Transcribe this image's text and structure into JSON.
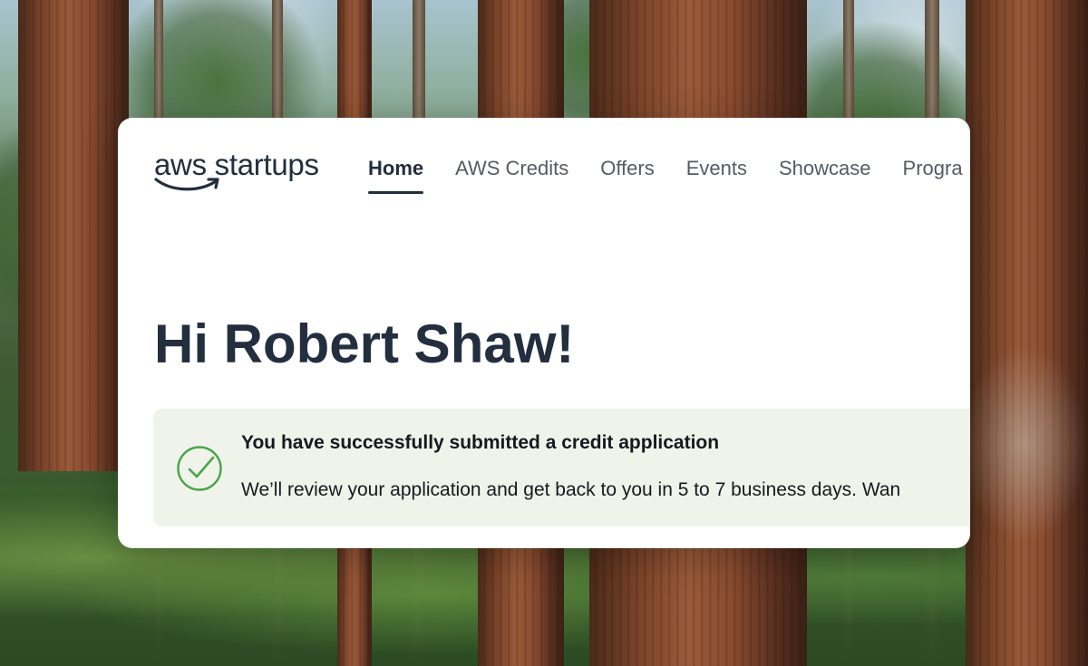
{
  "brand": {
    "logo_text": "aws startups",
    "accent_color": "#ff9900"
  },
  "nav": {
    "items": [
      {
        "label": "Home",
        "active": true
      },
      {
        "label": "AWS Credits",
        "active": false
      },
      {
        "label": "Offers",
        "active": false
      },
      {
        "label": "Events",
        "active": false
      },
      {
        "label": "Showcase",
        "active": false
      },
      {
        "label": "Progra",
        "active": false
      }
    ]
  },
  "main": {
    "greeting": "Hi Robert Shaw!"
  },
  "alert": {
    "icon": "check-circle-icon",
    "color": "#4aa34a",
    "title": "You have successfully submitted a credit application",
    "body": "We’ll review your application and get back to you in 5 to 7 business days. Wan"
  }
}
